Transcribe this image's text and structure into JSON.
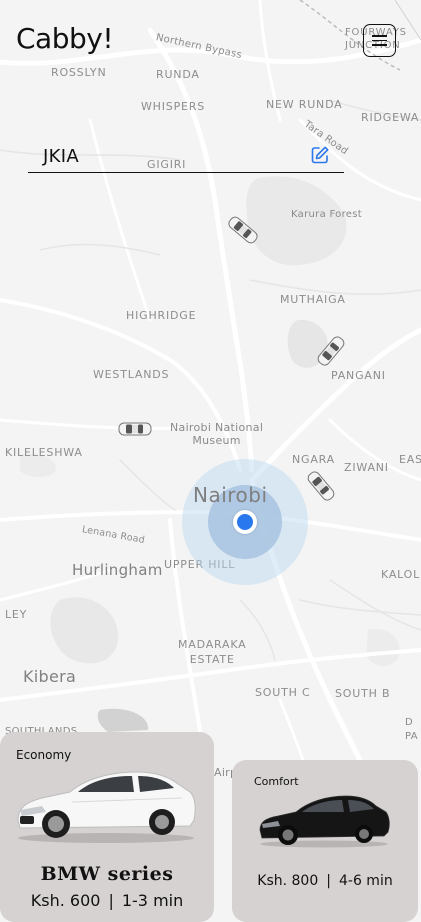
{
  "app": {
    "logo": "Cabby!",
    "menu_icon": "hamburger-menu-icon"
  },
  "destination": {
    "value": "JKIA",
    "edit_icon": "edit-pencil-icon"
  },
  "map": {
    "labels": {
      "fourways": "FOURWAYS\nJUNCTION",
      "northern_bypass": "Northern Bypass",
      "rosslyn": "ROSSLYN",
      "runda": "RUNDA",
      "whispers": "WHISPERS",
      "new_runda": "NEW RUNDA",
      "ridgeways": "RIDGEWA",
      "tara_road": "Tara Road",
      "gigiri": "GIGIRI",
      "karura_forest": "Karura Forest",
      "muthaiga": "MUTHAIGA",
      "highridge": "HIGHRIDGE",
      "pangani": "PANGANI",
      "westlands": "WESTLANDS",
      "museum": "Nairobi National\nMuseum",
      "kileleshwa": "KILELESHWA",
      "ngara": "NGARA",
      "ziwani": "ZIWANI",
      "eas": "EAS",
      "nairobi": "Nairobi",
      "lenana_road": "Lenana Road",
      "hurlingham": "Hurlingham",
      "upper_hill": "UPPER HILL",
      "kalol": "KALOL",
      "ley": "LEY",
      "madaraka": "MADARAKA\nESTATE",
      "kibera": "Kibera",
      "south_c": "SOUTH C",
      "south_b": "SOUTH B",
      "southlands": "SOUTHLANDS",
      "airp": "Airp",
      "pa": "D\nPA"
    }
  },
  "rides": [
    {
      "type": "Economy",
      "name": "BMW series",
      "price": "Ksh. 600",
      "separator": "|",
      "eta": "1-3 min",
      "color": "#ffffff"
    },
    {
      "type": "Comfort",
      "price": "Ksh. 800",
      "separator": "|",
      "eta": "4-6 min",
      "color": "#111111"
    }
  ],
  "colors": {
    "card_bg": "#d7d2d2",
    "location_dot": "#2a78ee",
    "accent_icon": "#2a78ee"
  }
}
